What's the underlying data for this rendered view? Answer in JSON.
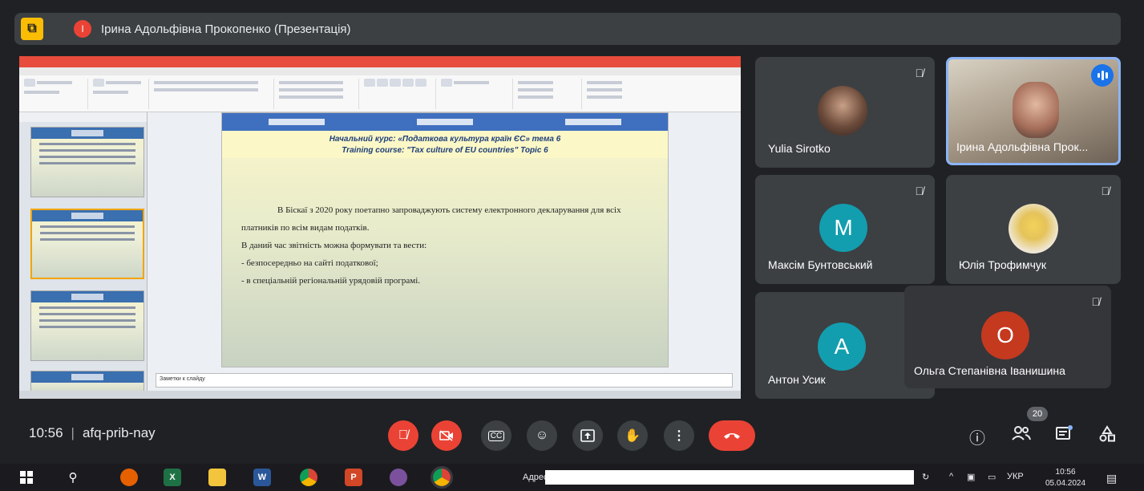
{
  "presenter_bar": {
    "avatar_letter": "І",
    "label": "Ірина Адольфівна Прокопенко (Презентація)"
  },
  "shared_screen": {
    "notes_placeholder": "Заметки к слайду",
    "slide": {
      "heading_line1": "Начальний курс: «Податкова культура країн ЄС» тема 6",
      "heading_line2": "Training course: \"Tax culture of EU countries\" Topic 6",
      "paragraph1": "В Біскаї з 2020 року поетапно запроваджують систему електронного декларування для всіх платників по всім видам податків.",
      "paragraph2": "В даний час звітність можна формувати та вести:",
      "bullet1": "-   безпосередньо на сайті податкової;",
      "bullet2": "-   в спеціальній регіональній урядовій програмі."
    }
  },
  "participants": [
    {
      "name": "Yulia Sirotko",
      "muted": true
    },
    {
      "name": "Ірина Адольфівна Прок...",
      "speaking": true
    },
    {
      "name": "Максім Бунтовський",
      "letter": "M",
      "color": "#129eaf",
      "muted": true
    },
    {
      "name": "Юлія Трофимчук",
      "muted": true
    },
    {
      "name": "Антон Усик",
      "letter": "A",
      "color": "#129eaf"
    },
    {
      "name": "Ольга Степанівна Іванишина",
      "letter": "O",
      "color": "#c5391f",
      "muted": true
    }
  ],
  "meeting": {
    "time": "10:56",
    "separator": "|",
    "code": "afq-prib-nay",
    "participant_count": "20"
  },
  "taskbar": {
    "address_label": "Адрес",
    "language": "УКР",
    "clock_time": "10:56",
    "clock_date": "05.04.2024"
  },
  "icons": {
    "mic_off": "🎙̸",
    "camera_off": "cam-off",
    "captions": "CC",
    "emoji": "☺",
    "present": "⬆",
    "raise_hand": "✋",
    "more": "⋮",
    "end_call": "☎",
    "info": "ⓘ",
    "people": "👥",
    "chat": "💬",
    "activities": "⛶"
  }
}
